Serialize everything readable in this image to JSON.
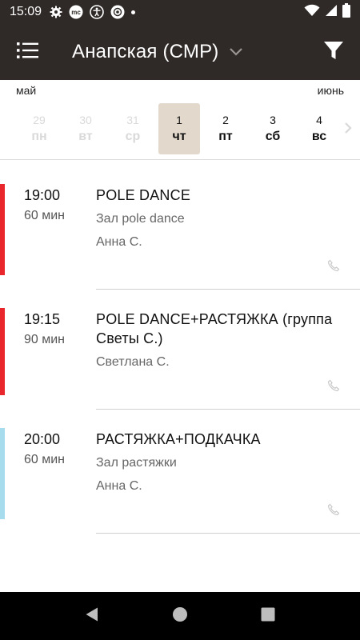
{
  "status_bar": {
    "time": "15:09",
    "icons": [
      "settings-icon",
      "mc-app-icon",
      "accessibility-icon",
      "camera-app-icon",
      "notification-dot-icon"
    ],
    "right_icons": [
      "wifi-icon",
      "signal-icon",
      "battery-icon"
    ]
  },
  "app_bar": {
    "title": "Анапская (СМР)",
    "menu_icon": "menu-list-icon",
    "dropdown_icon": "chevron-down-icon",
    "filter_icon": "filter-icon"
  },
  "months": {
    "left": "май",
    "right": "июнь"
  },
  "days": [
    {
      "num": "29",
      "wd": "пн",
      "state": "past"
    },
    {
      "num": "30",
      "wd": "вт",
      "state": "past"
    },
    {
      "num": "31",
      "wd": "ср",
      "state": "past"
    },
    {
      "num": "1",
      "wd": "чт",
      "state": "selected"
    },
    {
      "num": "2",
      "wd": "пт",
      "state": "future"
    },
    {
      "num": "3",
      "wd": "сб",
      "state": "future"
    },
    {
      "num": "4",
      "wd": "вс",
      "state": "future"
    }
  ],
  "sessions": [
    {
      "time": "19:00",
      "duration": "60 мин",
      "title": "POLE DANCE",
      "hall": "Зал pole dance",
      "trainer": "Анна С.",
      "color": "#e8262b"
    },
    {
      "time": "19:15",
      "duration": "90 мин",
      "title": "POLE DANCE+РАСТЯЖКА (группа Светы С.)",
      "hall": "",
      "trainer": "Светлана С.",
      "color": "#e8262b"
    },
    {
      "time": "20:00",
      "duration": "60 мин",
      "title": "РАСТЯЖКА+ПОДКАЧКА",
      "hall": "Зал растяжки",
      "trainer": "Анна С.",
      "color": "#a6dcee"
    }
  ],
  "colors": {
    "app_bar": "#2f2a27",
    "selected_day": "#e2d9cc",
    "accent_red": "#e8262b",
    "accent_blue": "#a6dcee"
  }
}
